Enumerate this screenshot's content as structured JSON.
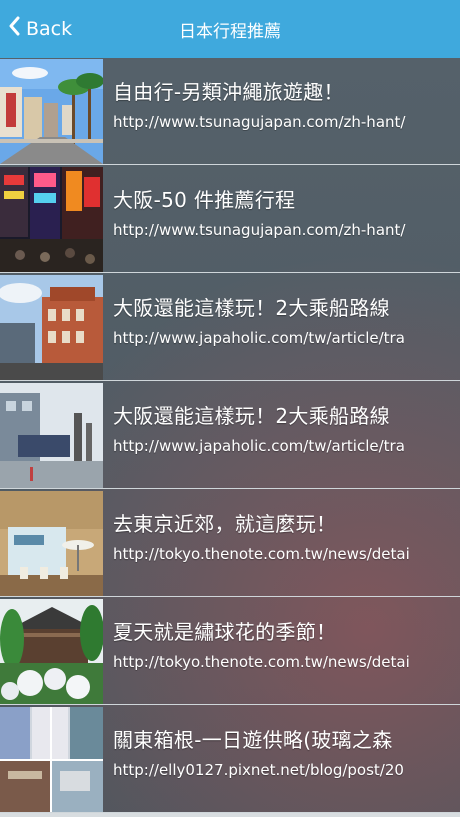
{
  "header": {
    "back_label": "Back",
    "title": "日本行程推薦",
    "back_icon": "chevron-left-icon"
  },
  "items": [
    {
      "title": "自由行-另類沖繩旅遊趣！",
      "url": "http://www.tsunagujapan.com/zh-hant/"
    },
    {
      "title": "大阪-50 件推薦行程",
      "url": "http://www.tsunagujapan.com/zh-hant/"
    },
    {
      "title": " 大阪還能這樣玩！2大乘船路線",
      "url": "http://www.japaholic.com/tw/article/tra"
    },
    {
      "title": " 大阪還能這樣玩！2大乘船路線",
      "url": "http://www.japaholic.com/tw/article/tra"
    },
    {
      "title": "去東京近郊，就這麼玩！",
      "url": "http://tokyo.thenote.com.tw/news/detai"
    },
    {
      "title": "夏天就是繡球花的季節！",
      "url": "http://tokyo.thenote.com.tw/news/detai"
    },
    {
      "title": "關東箱根-一日遊供略(玻璃之森",
      "url": "http://elly0127.pixnet.net/blog/post/20"
    }
  ],
  "colors": {
    "header_bg": "#3fa9dd",
    "list_bg": "#55616a",
    "divider": "#cfd6da"
  }
}
